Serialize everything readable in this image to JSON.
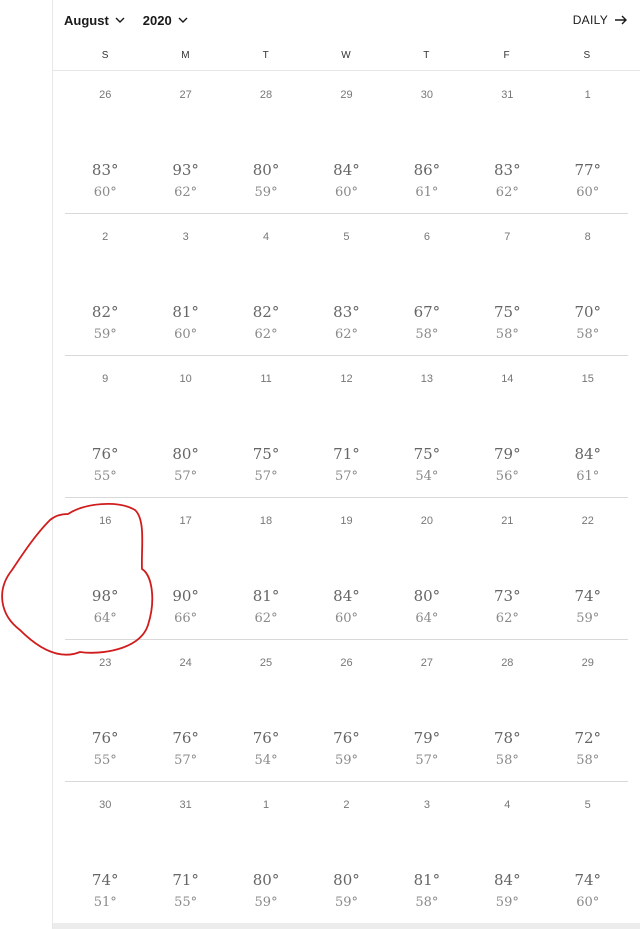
{
  "header": {
    "month": "August",
    "year": "2020",
    "view_label": "DAILY"
  },
  "weekdays": [
    "S",
    "M",
    "T",
    "W",
    "T",
    "F",
    "S"
  ],
  "weeks": [
    {
      "days": [
        {
          "date": "26",
          "hi": "83°",
          "lo": "60°"
        },
        {
          "date": "27",
          "hi": "93°",
          "lo": "62°"
        },
        {
          "date": "28",
          "hi": "80°",
          "lo": "59°"
        },
        {
          "date": "29",
          "hi": "84°",
          "lo": "60°"
        },
        {
          "date": "30",
          "hi": "86°",
          "lo": "61°"
        },
        {
          "date": "31",
          "hi": "83°",
          "lo": "62°"
        },
        {
          "date": "1",
          "hi": "77°",
          "lo": "60°"
        }
      ]
    },
    {
      "days": [
        {
          "date": "2",
          "hi": "82°",
          "lo": "59°"
        },
        {
          "date": "3",
          "hi": "81°",
          "lo": "60°"
        },
        {
          "date": "4",
          "hi": "82°",
          "lo": "62°"
        },
        {
          "date": "5",
          "hi": "83°",
          "lo": "62°"
        },
        {
          "date": "6",
          "hi": "67°",
          "lo": "58°"
        },
        {
          "date": "7",
          "hi": "75°",
          "lo": "58°"
        },
        {
          "date": "8",
          "hi": "70°",
          "lo": "58°"
        }
      ]
    },
    {
      "days": [
        {
          "date": "9",
          "hi": "76°",
          "lo": "55°"
        },
        {
          "date": "10",
          "hi": "80°",
          "lo": "57°"
        },
        {
          "date": "11",
          "hi": "75°",
          "lo": "57°"
        },
        {
          "date": "12",
          "hi": "71°",
          "lo": "57°"
        },
        {
          "date": "13",
          "hi": "75°",
          "lo": "54°"
        },
        {
          "date": "14",
          "hi": "79°",
          "lo": "56°"
        },
        {
          "date": "15",
          "hi": "84°",
          "lo": "61°"
        }
      ]
    },
    {
      "days": [
        {
          "date": "16",
          "hi": "98°",
          "lo": "64°"
        },
        {
          "date": "17",
          "hi": "90°",
          "lo": "66°"
        },
        {
          "date": "18",
          "hi": "81°",
          "lo": "62°"
        },
        {
          "date": "19",
          "hi": "84°",
          "lo": "60°"
        },
        {
          "date": "20",
          "hi": "80°",
          "lo": "64°"
        },
        {
          "date": "21",
          "hi": "73°",
          "lo": "62°"
        },
        {
          "date": "22",
          "hi": "74°",
          "lo": "59°"
        }
      ]
    },
    {
      "days": [
        {
          "date": "23",
          "hi": "76°",
          "lo": "55°"
        },
        {
          "date": "24",
          "hi": "76°",
          "lo": "57°"
        },
        {
          "date": "25",
          "hi": "76°",
          "lo": "54°"
        },
        {
          "date": "26",
          "hi": "76°",
          "lo": "59°"
        },
        {
          "date": "27",
          "hi": "79°",
          "lo": "57°"
        },
        {
          "date": "28",
          "hi": "78°",
          "lo": "58°"
        },
        {
          "date": "29",
          "hi": "72°",
          "lo": "58°"
        }
      ]
    },
    {
      "days": [
        {
          "date": "30",
          "hi": "74°",
          "lo": "51°"
        },
        {
          "date": "31",
          "hi": "71°",
          "lo": "55°"
        },
        {
          "date": "1",
          "hi": "80°",
          "lo": "59°"
        },
        {
          "date": "2",
          "hi": "80°",
          "lo": "59°"
        },
        {
          "date": "3",
          "hi": "81°",
          "lo": "58°"
        },
        {
          "date": "4",
          "hi": "84°",
          "lo": "59°"
        },
        {
          "date": "5",
          "hi": "74°",
          "lo": "60°"
        }
      ]
    }
  ],
  "colors": {
    "annotation": "#d01c1c",
    "separator": "#d9d9d9"
  },
  "icons": {
    "dropdown": "chevron-down-icon",
    "forward": "arrow-right-icon"
  }
}
